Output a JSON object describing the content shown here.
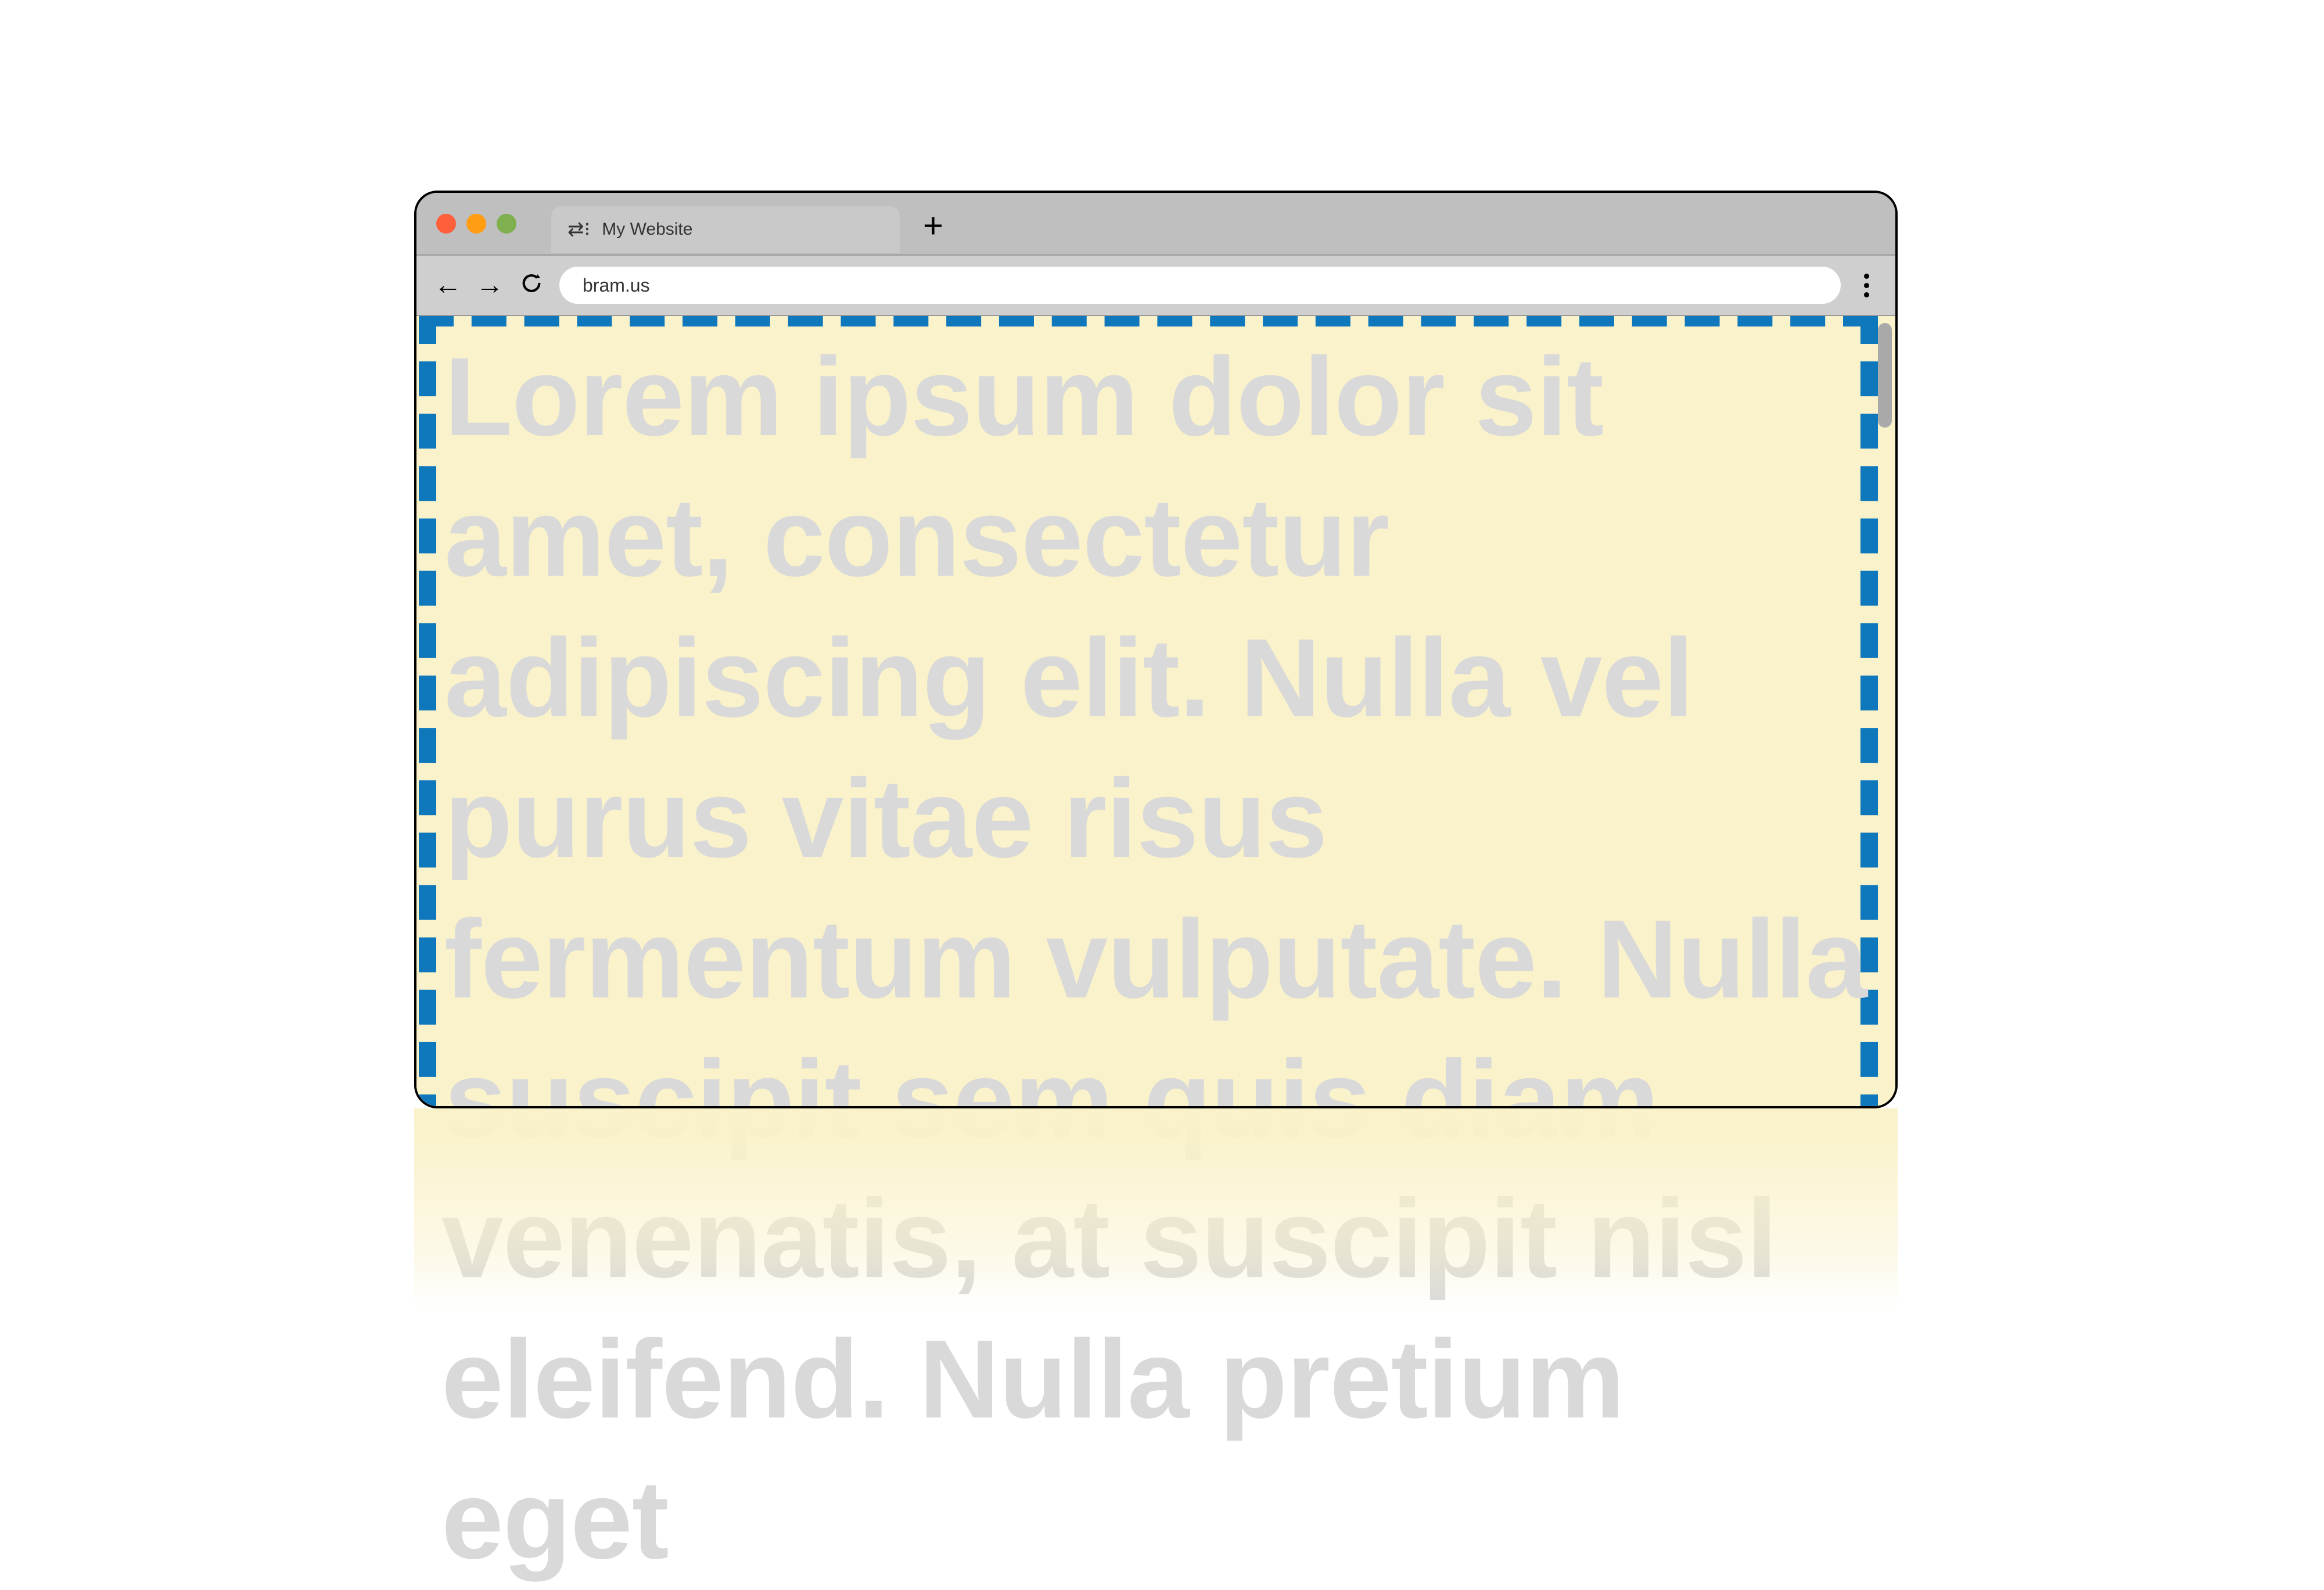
{
  "tab": {
    "title": "My Website"
  },
  "toolbar": {
    "url": "bram.us"
  },
  "colors": {
    "accent_border": "#0f78bc",
    "page_bg": "#f9f2ca"
  },
  "page": {
    "body_text": "Lorem ipsum dolor sit amet, consectetur adipiscing elit. Nulla vel purus vitae risus fermentum vulputate. Nulla suscipit sem quis diam venenatis, at suscipit nisl eleifend. Nulla pretium eget"
  }
}
